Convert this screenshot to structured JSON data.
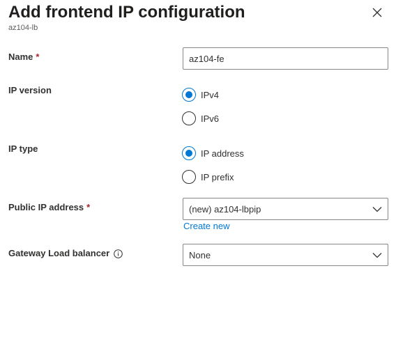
{
  "header": {
    "title": "Add frontend IP configuration",
    "subtitle": "az104-lb"
  },
  "fields": {
    "name": {
      "label": "Name",
      "required_marker": "*",
      "value": "az104-fe"
    },
    "ip_version": {
      "label": "IP version",
      "options": [
        {
          "label": "IPv4",
          "selected": true
        },
        {
          "label": "IPv6",
          "selected": false
        }
      ]
    },
    "ip_type": {
      "label": "IP type",
      "options": [
        {
          "label": "IP address",
          "selected": true
        },
        {
          "label": "IP prefix",
          "selected": false
        }
      ]
    },
    "public_ip": {
      "label": "Public IP address",
      "required_marker": "*",
      "value": "(new) az104-lbpip",
      "link": "Create new"
    },
    "gateway_lb": {
      "label": "Gateway Load balancer",
      "value": "None"
    }
  },
  "icons": {
    "close": "close-icon",
    "info": "info-icon",
    "chevron": "chevron-down-icon"
  },
  "colors": {
    "accent": "#0078d4",
    "required": "#a4262c",
    "text": "#323130",
    "border": "#8a8886"
  }
}
